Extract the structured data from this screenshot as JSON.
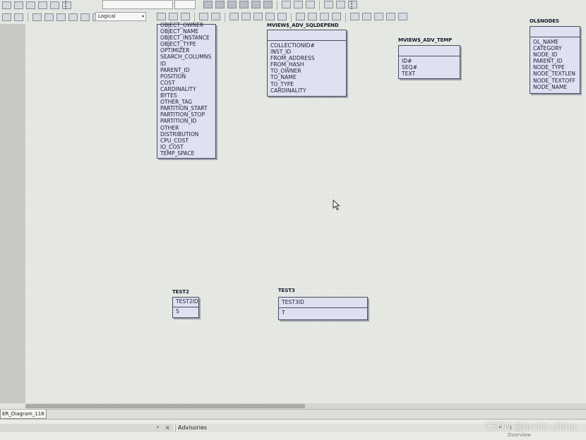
{
  "toolbar": {
    "mode_combo": "Logical",
    "mode_arrow": "▾"
  },
  "entities": {
    "partial_table": {
      "attributes": [
        "OBJECT_OWNER",
        "OBJECT_NAME",
        "OBJECT_INSTANCE",
        "OBJECT_TYPE",
        "OPTIMIZER",
        "SEARCH_COLUMNS",
        "ID",
        "PARENT_ID",
        "POSITION",
        "COST",
        "CARDINALITY",
        "BYTES",
        "OTHER_TAG",
        "PARTITION_START",
        "PARTITION_STOP",
        "PARTITION_ID",
        "OTHER",
        "DISTRIBUTION",
        "CPU_COST",
        "IO_COST",
        "TEMP_SPACE"
      ]
    },
    "mview_adv_sqldepend": {
      "title": "MVIEW$_ADV_SQLDEPEND",
      "attributes": [
        "COLLECTIONID#",
        "INST_ID",
        "FROM_ADDRESS",
        "FROM_HASH",
        "TO_OWNER",
        "TO_NAME",
        "TO_TYPE",
        "CARDINALITY"
      ]
    },
    "mview_adv_temp": {
      "title": "MVIEW$_ADV_TEMP",
      "attributes": [
        "ID#",
        "SEQ#",
        "TEXT"
      ]
    },
    "ol_nodes": {
      "title": "OL$NODES",
      "attributes": [
        "OL_NAME",
        "CATEGORY",
        "NODE_ID",
        "PARENT_ID",
        "NODE_TYPE",
        "NODE_TEXTLEN",
        "NODE_TEXTOFF",
        "NODE_NAME"
      ]
    },
    "test2": {
      "title": "TEST2",
      "pk": "TEST2ID",
      "attributes": [
        "S"
      ]
    },
    "test3": {
      "title": "TEST3",
      "pk": "TEST3ID",
      "attributes": [
        "T"
      ]
    }
  },
  "tabs": {
    "diagram_tab": "ER_Diagram_116"
  },
  "panels": {
    "advisories": "Advisories",
    "overview": "Overview",
    "pin": "ᵖ",
    "close": "×"
  },
  "watermark": "CSDN @erwin china"
}
